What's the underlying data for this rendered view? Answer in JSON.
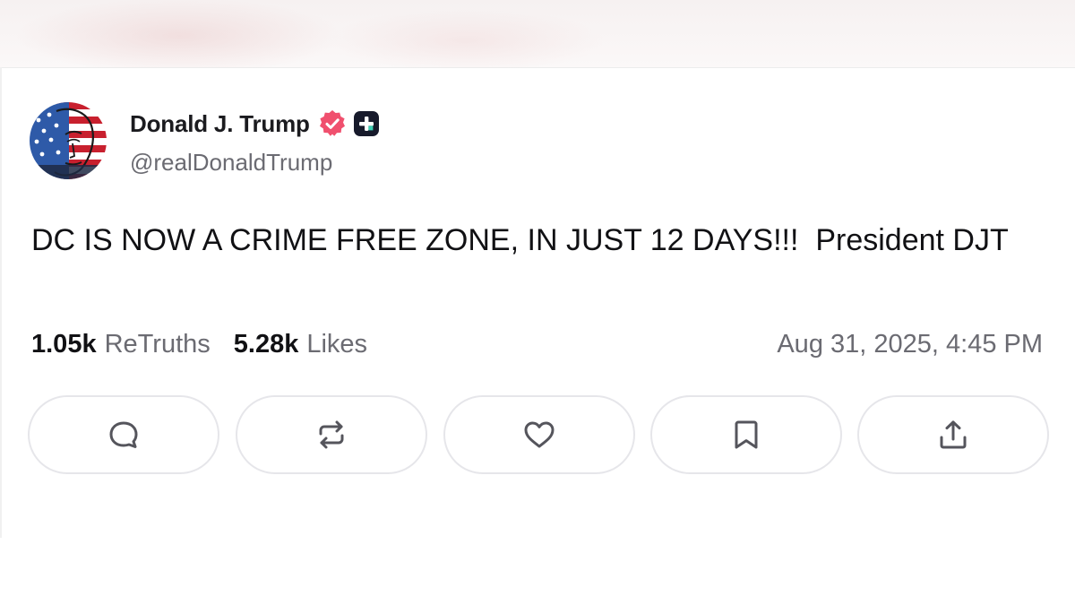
{
  "author": {
    "display_name": "Donald J. Trump",
    "handle": "@realDonaldTrump",
    "verified_icon": "verified-badge-icon",
    "platform_icon": "truth-plus-icon",
    "verified_color": "#f0506e"
  },
  "post": {
    "text": "DC IS NOW A CRIME FREE ZONE, IN JUST 12 DAYS!!!  President DJT"
  },
  "stats": {
    "retruths_count": "1.05k",
    "retruths_label": "ReTruths",
    "likes_count": "5.28k",
    "likes_label": "Likes",
    "timestamp": "Aug 31, 2025, 4:45 PM"
  },
  "actions": [
    {
      "name": "reply",
      "icon": "comment-icon"
    },
    {
      "name": "retruth",
      "icon": "repost-icon"
    },
    {
      "name": "like",
      "icon": "heart-icon"
    },
    {
      "name": "bookmark",
      "icon": "bookmark-icon"
    },
    {
      "name": "share",
      "icon": "share-icon"
    }
  ],
  "colors": {
    "text_primary": "#111114",
    "text_secondary": "#6b6b72",
    "button_border": "#e6e6ea",
    "icon_stroke": "#55555c"
  }
}
